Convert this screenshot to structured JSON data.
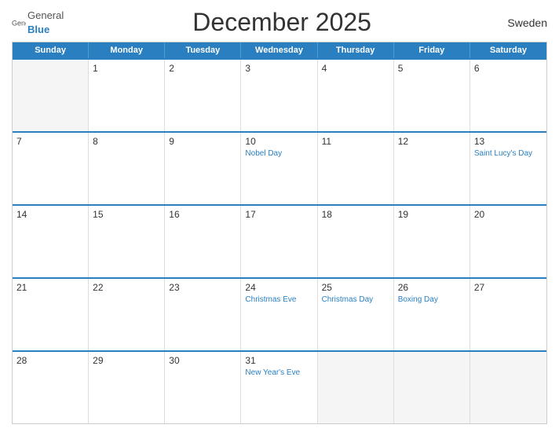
{
  "header": {
    "logo_general": "General",
    "logo_blue": "Blue",
    "title": "December 2025",
    "country": "Sweden"
  },
  "weekdays": [
    "Sunday",
    "Monday",
    "Tuesday",
    "Wednesday",
    "Thursday",
    "Friday",
    "Saturday"
  ],
  "weeks": [
    [
      {
        "day": "",
        "empty": true
      },
      {
        "day": "1",
        "empty": false,
        "event": ""
      },
      {
        "day": "2",
        "empty": false,
        "event": ""
      },
      {
        "day": "3",
        "empty": false,
        "event": ""
      },
      {
        "day": "4",
        "empty": false,
        "event": ""
      },
      {
        "day": "5",
        "empty": false,
        "event": ""
      },
      {
        "day": "6",
        "empty": false,
        "event": ""
      }
    ],
    [
      {
        "day": "7",
        "empty": false,
        "event": ""
      },
      {
        "day": "8",
        "empty": false,
        "event": ""
      },
      {
        "day": "9",
        "empty": false,
        "event": ""
      },
      {
        "day": "10",
        "empty": false,
        "event": "Nobel Day"
      },
      {
        "day": "11",
        "empty": false,
        "event": ""
      },
      {
        "day": "12",
        "empty": false,
        "event": ""
      },
      {
        "day": "13",
        "empty": false,
        "event": "Saint Lucy's Day"
      }
    ],
    [
      {
        "day": "14",
        "empty": false,
        "event": ""
      },
      {
        "day": "15",
        "empty": false,
        "event": ""
      },
      {
        "day": "16",
        "empty": false,
        "event": ""
      },
      {
        "day": "17",
        "empty": false,
        "event": ""
      },
      {
        "day": "18",
        "empty": false,
        "event": ""
      },
      {
        "day": "19",
        "empty": false,
        "event": ""
      },
      {
        "day": "20",
        "empty": false,
        "event": ""
      }
    ],
    [
      {
        "day": "21",
        "empty": false,
        "event": ""
      },
      {
        "day": "22",
        "empty": false,
        "event": ""
      },
      {
        "day": "23",
        "empty": false,
        "event": ""
      },
      {
        "day": "24",
        "empty": false,
        "event": "Christmas Eve"
      },
      {
        "day": "25",
        "empty": false,
        "event": "Christmas Day"
      },
      {
        "day": "26",
        "empty": false,
        "event": "Boxing Day"
      },
      {
        "day": "27",
        "empty": false,
        "event": ""
      }
    ],
    [
      {
        "day": "28",
        "empty": false,
        "event": ""
      },
      {
        "day": "29",
        "empty": false,
        "event": ""
      },
      {
        "day": "30",
        "empty": false,
        "event": ""
      },
      {
        "day": "31",
        "empty": false,
        "event": "New Year's Eve"
      },
      {
        "day": "",
        "empty": true,
        "event": ""
      },
      {
        "day": "",
        "empty": true,
        "event": ""
      },
      {
        "day": "",
        "empty": true,
        "event": ""
      }
    ]
  ]
}
